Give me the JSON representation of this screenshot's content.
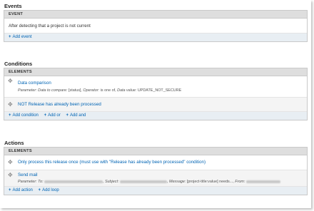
{
  "events": {
    "title": "Events",
    "header": "EVENT",
    "item": "After detecting that a project is not current",
    "add_event": "Add event"
  },
  "conditions": {
    "title": "Conditions",
    "header": "ELEMENTS",
    "items": [
      {
        "label": "Data comparison",
        "params": {
          "p1": "Parameter:",
          "k1": "Data to compare:",
          "v1": "[status],",
          "k2": "Operator:",
          "v2": "is one of,",
          "k3": "Data value:",
          "v3": "UPDATE_NOT_SECURE"
        }
      },
      {
        "label": "NOT Release has already been processed"
      }
    ],
    "add_condition": "Add condition",
    "add_or": "Add or",
    "add_and": "Add and"
  },
  "actions": {
    "title": "Actions",
    "header": "ELEMENTS",
    "items": [
      {
        "label": "Only process this release once (must use with \"Release has already been processed\" condition)"
      },
      {
        "label": "Send mail",
        "params": {
          "p1": "Parameter:",
          "k1": "To:",
          "k2": ", Subject:",
          "k3": ", Message:",
          "v3": "[project-title:value] needs...,",
          "k4": "From:"
        }
      }
    ],
    "add_action": "Add action",
    "add_loop": "Add loop"
  },
  "icons": {
    "drag": "drag-handle-icon",
    "plus": "plus-icon"
  },
  "colors": {
    "link": "#0064b4",
    "header_bg": "#dedede",
    "footer_bg": "#e8eef3"
  }
}
